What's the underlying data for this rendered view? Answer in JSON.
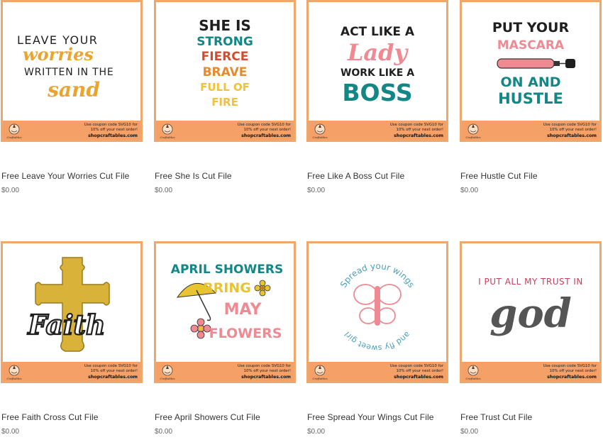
{
  "promo": {
    "line1": "Use coupon code SVG10 for",
    "line2": "10% off your next order!",
    "site": "shopcraftables.com",
    "logo_text": "Craftables",
    "logo_icon": "unicorn-logo-icon"
  },
  "colors": {
    "thumb_border": "#f0a76b",
    "strip": "#f4a066",
    "orange_text": "#e9a530",
    "teal": "#138686",
    "pink": "#ef8a93",
    "red": "#d64b2e",
    "gold": "#d9b23a",
    "dark": "#1f1f1f"
  },
  "products": [
    {
      "title": "Free Leave Your Worries Cut File",
      "price": "$0.00",
      "art": [
        "LEAVE YOUR",
        "worries",
        "WRITTEN IN THE",
        "sand"
      ]
    },
    {
      "title": "Free She Is Cut File",
      "price": "$0.00",
      "art": [
        "SHE IS",
        "STRONG",
        "FIERCE",
        "BRAVE",
        "FULL OF",
        "FIRE"
      ]
    },
    {
      "title": "Free Like A Boss Cut File",
      "price": "$0.00",
      "art": [
        "ACT LIKE A",
        "Lady",
        "WORK LIKE A",
        "BOSS"
      ]
    },
    {
      "title": "Free Hustle Cut File",
      "price": "$0.00",
      "art": [
        "PUT YOUR",
        "MASCARA",
        "ON AND",
        "HUSTLE"
      ]
    },
    {
      "title": "Free Faith Cross Cut File",
      "price": "$0.00",
      "art": [
        "Faith"
      ]
    },
    {
      "title": "Free April Showers Cut File",
      "price": "$0.00",
      "art": [
        "APRIL SHOWERS",
        "BRING",
        "MAY",
        "FLOWERS"
      ]
    },
    {
      "title": "Free Spread Your Wings Cut File",
      "price": "$0.00",
      "art": [
        "Spread your wings",
        "and fly sweet girl"
      ]
    },
    {
      "title": "Free Trust Cut File",
      "price": "$0.00",
      "art": [
        "I PUT ALL MY TRUST IN",
        "god"
      ]
    }
  ]
}
